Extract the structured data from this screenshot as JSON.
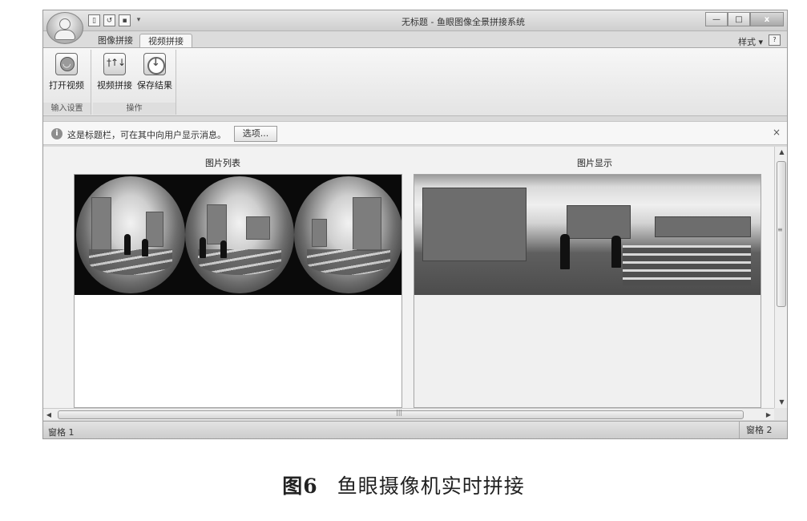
{
  "window": {
    "title": "无标题 - 鱼眼图像全景拼接系统",
    "controls": {
      "minimize": "—",
      "maximize": "□",
      "close": "x"
    }
  },
  "qat": {
    "new": "▯",
    "open": "↺",
    "save": "▪",
    "dropdown": "▾"
  },
  "tabs": [
    {
      "label": "图像拼接",
      "active": false
    },
    {
      "label": "视频拼接",
      "active": true
    }
  ],
  "style_menu": "样式 ▾",
  "ribbon": {
    "groups": [
      {
        "label": "输入设置",
        "buttons": [
          {
            "label": "打开视频",
            "icon": "smile-camera-icon"
          }
        ]
      },
      {
        "label": "操作",
        "buttons": [
          {
            "label": "视频拼接",
            "icon": "mixer-icon"
          },
          {
            "label": "保存结果",
            "icon": "save-download-icon"
          }
        ]
      }
    ]
  },
  "message_bar": {
    "text": "这是标题栏，可在其中向用户显示消息。",
    "option_button": "选项...",
    "close": "×"
  },
  "panels": {
    "left_title": "图片列表",
    "right_title": "图片显示"
  },
  "scrollbars": {
    "grip": "≡",
    "hgrip": "|||"
  },
  "statusbar": {
    "pane1": "窗格 1",
    "pane2": "窗格 2"
  },
  "caption": {
    "number": "图6",
    "text": "鱼眼摄像机实时拼接"
  }
}
